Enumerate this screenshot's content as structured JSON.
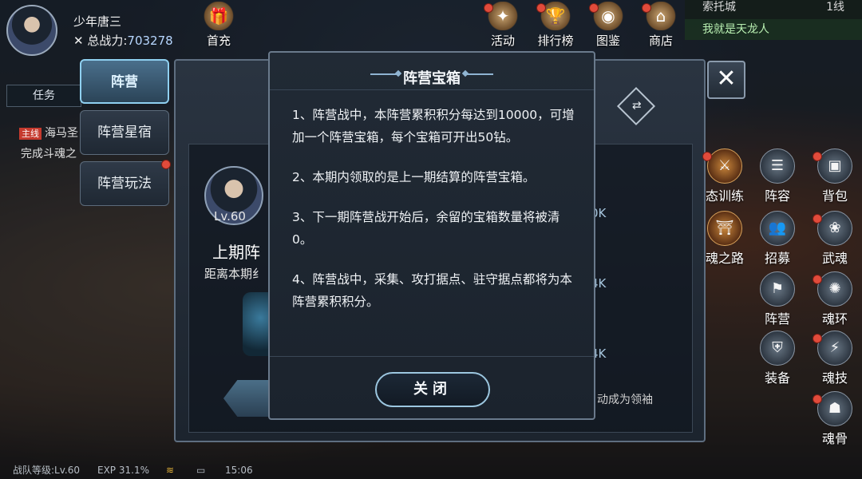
{
  "player": {
    "name": "少年唐三",
    "power_label": "总战力:",
    "power_value": "703278"
  },
  "top_menu": [
    {
      "label": "首充",
      "icon": "gift-icon"
    },
    {
      "label": "活动",
      "icon": "event-icon"
    },
    {
      "label": "排行榜",
      "icon": "trophy-icon"
    },
    {
      "label": "图鉴",
      "icon": "codex-icon"
    },
    {
      "label": "商店",
      "icon": "shop-icon"
    }
  ],
  "location": {
    "city": "索托城",
    "line": "1线"
  },
  "chat_line": "我就是天龙人",
  "task": {
    "tab_label": "任务",
    "main_tag": "主线",
    "line1": "海马圣",
    "line2": "完成斗魂之"
  },
  "camp_tabs": [
    {
      "label": "阵营",
      "active": true
    },
    {
      "label": "阵营星宿",
      "active": false
    },
    {
      "label": "阵营玩法",
      "active": false
    }
  ],
  "camp_panel": {
    "level": "Lv.60",
    "last_period": "上期阵",
    "distance": "距离本期纟",
    "rank_values": [
      "0K",
      "4K",
      "4K"
    ],
    "lead_text": "动成为领袖",
    "swap_glyph": "⇄"
  },
  "close_glyph": "✕",
  "right_icons": [
    {
      "label": "态训练",
      "icon": "training-icon"
    },
    {
      "label": "阵容",
      "icon": "lineup-icon"
    },
    {
      "label": "背包",
      "icon": "bag-icon"
    },
    {
      "label": "魂之路",
      "icon": "soul-road-icon"
    },
    {
      "label": "招募",
      "icon": "recruit-icon"
    },
    {
      "label": "武魂",
      "icon": "martial-soul-icon"
    },
    {
      "label": "阵营",
      "icon": "camp-icon"
    },
    {
      "label": "魂环",
      "icon": "soul-ring-icon"
    },
    {
      "label": "装备",
      "icon": "equipment-icon"
    },
    {
      "label": "魂技",
      "icon": "soul-skill-icon"
    },
    {
      "label": "魂骨",
      "icon": "soul-bone-icon"
    }
  ],
  "status_bar": {
    "team_level": "战队等级:Lv.60",
    "exp": "EXP 31.1%",
    "time": "15:06"
  },
  "modal": {
    "title": "阵营宝箱",
    "paragraphs": [
      "1、阵营战中，本阵营累积积分每达到10000，可增加一个阵营宝箱，每个宝箱可开出50钻。",
      "2、本期内领取的是上一期结算的阵营宝箱。",
      "3、下一期阵营战开始后，余留的宝箱数量将被清0。",
      "4、阵营战中，采集、攻打据点、驻守据点都将为本阵营累积积分。"
    ],
    "close_button": "关闭"
  }
}
